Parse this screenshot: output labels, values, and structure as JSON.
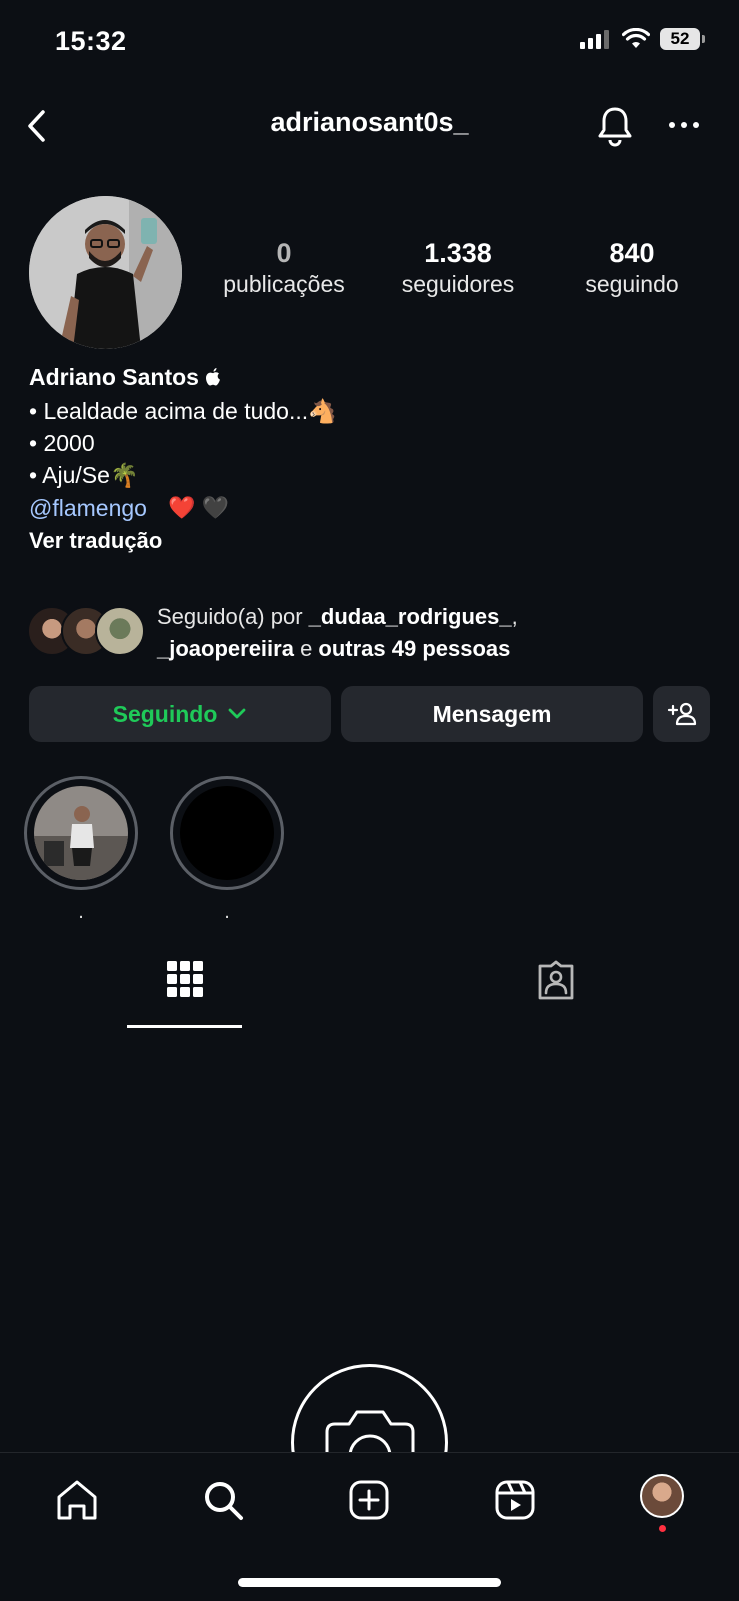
{
  "status_bar": {
    "time": "15:32",
    "battery": "52"
  },
  "header": {
    "username": "adrianosant0s_"
  },
  "stats": [
    {
      "value": "0",
      "label": "publicações"
    },
    {
      "value": "1.338",
      "label": "seguidores"
    },
    {
      "value": "840",
      "label": "seguindo"
    }
  ],
  "bio": {
    "name": "Adriano Santos ",
    "lines": [
      "• Lealdade acima de tudo...🐴",
      "• 2000",
      "• Aju/Se🌴"
    ],
    "mention": "@flamengo",
    "hearts": "❤️ 🖤",
    "translate": "Ver tradução"
  },
  "followed_by": {
    "prefix": "Seguido(a) por ",
    "user1": "_dudaa_rodrigues_",
    "comma": ",",
    "user2": "_joaopereiira",
    "and": " e ",
    "others": "outras 49 pessoas"
  },
  "buttons": {
    "following": "Seguindo",
    "message": "Mensagem"
  },
  "highlights": [
    {
      "label": "."
    },
    {
      "label": "."
    }
  ],
  "icons": [
    "back-icon",
    "bell-icon",
    "more-icon",
    "apple-icon",
    "chevron-down-icon",
    "add-person-icon",
    "grid-icon",
    "tagged-icon",
    "camera-icon",
    "home-icon",
    "search-icon",
    "create-icon",
    "reels-icon"
  ],
  "colors": {
    "background": "#0c0f14",
    "following_green": "#1fca59",
    "mention_blue": "#a6c8ff",
    "button_bg": "#25282e",
    "notification_dot": "#ff3040"
  }
}
